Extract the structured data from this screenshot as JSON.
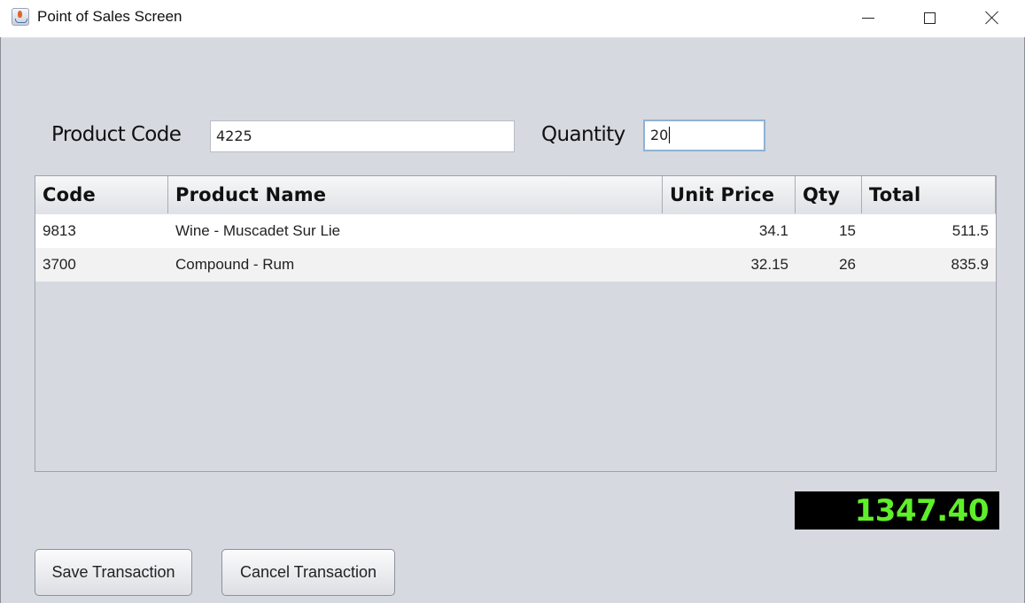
{
  "window": {
    "title": "Point of Sales Screen",
    "controls": {
      "minimize": "minimize",
      "maximize": "maximize",
      "close": "close"
    }
  },
  "form": {
    "product_code_label": "Product Code",
    "product_code_value": "4225",
    "quantity_label": "Quantity",
    "quantity_value": "20"
  },
  "table": {
    "columns": [
      "Code",
      "Product Name",
      "Unit Price",
      "Qty",
      "Total"
    ],
    "rows": [
      {
        "code": "9813",
        "name": "Wine - Muscadet Sur Lie",
        "unit_price": "34.1",
        "qty": "15",
        "total": "511.5"
      },
      {
        "code": "3700",
        "name": "Compound - Rum",
        "unit_price": "32.15",
        "qty": "26",
        "total": "835.9"
      }
    ]
  },
  "grand_total": "1347.40",
  "colors": {
    "total_text": "#5fef2a",
    "total_background": "#000000",
    "window_background": "#d6d9e0"
  },
  "buttons": {
    "save": "Save Transaction",
    "cancel": "Cancel Transaction"
  }
}
